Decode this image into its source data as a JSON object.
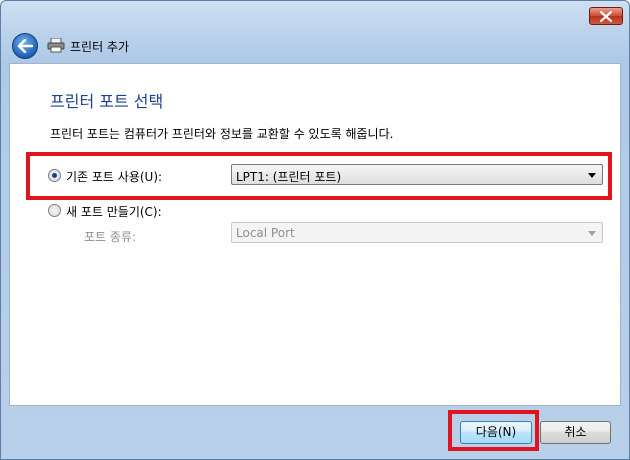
{
  "window": {
    "title": "프린터 추가",
    "icons": {
      "back": "back-arrow-icon",
      "printer": "printer-icon",
      "close": "close-icon"
    }
  },
  "page": {
    "heading": "프린터 포트 선택",
    "description": "프린터 포트는 컴퓨터가 프린터와 정보를 교환할 수 있도록 해줍니다."
  },
  "options": {
    "existing": {
      "label": "기존 포트 사용(U):",
      "selected": true,
      "value": "LPT1: (프린터 포트)"
    },
    "new": {
      "label": "새 포트 만들기(C):",
      "selected": false,
      "type_label": "포트 종류:",
      "value": "Local Port"
    }
  },
  "buttons": {
    "next": "다음(N)",
    "cancel": "취소"
  },
  "colors": {
    "highlight": "#e0141e",
    "heading": "#1e3f95"
  }
}
